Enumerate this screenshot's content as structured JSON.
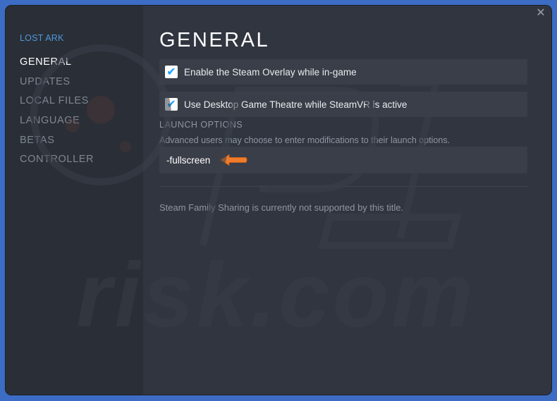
{
  "sidebar": {
    "game_title": "LOST ARK",
    "items": [
      {
        "label": "GENERAL",
        "active": true
      },
      {
        "label": "UPDATES",
        "active": false
      },
      {
        "label": "LOCAL FILES",
        "active": false
      },
      {
        "label": "LANGUAGE",
        "active": false
      },
      {
        "label": "BETAS",
        "active": false
      },
      {
        "label": "CONTROLLER",
        "active": false
      }
    ]
  },
  "main": {
    "title": "GENERAL",
    "close_icon": "close-icon",
    "options": [
      {
        "label": "Enable the Steam Overlay while in-game",
        "checked": true
      },
      {
        "label": "Use Desktop Game Theatre while SteamVR is active",
        "checked": true
      }
    ],
    "launch_options": {
      "heading": "LAUNCH OPTIONS",
      "description": "Advanced users may choose to enter modifications to their launch options.",
      "value": "-fullscreen",
      "annotation_icon": "orange-arrow-left-icon"
    },
    "family_sharing_text": "Steam Family Sharing is currently not supported by this title."
  },
  "watermark": "risk.com",
  "colors": {
    "window_bg": "#313540",
    "sidebar_bg": "#2a2e36",
    "accent_blue": "#4f99dc",
    "checkbox_check": "#1a9fff",
    "annotation_orange": "#f07b2a",
    "outer_bg": "#3c6cc4"
  }
}
